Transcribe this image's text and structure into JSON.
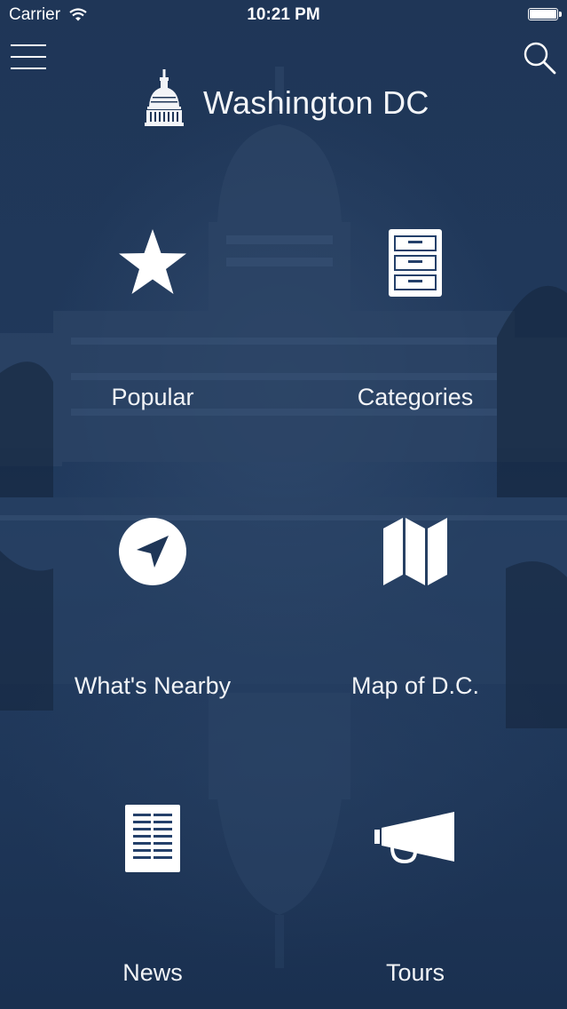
{
  "status_bar": {
    "carrier": "Carrier",
    "time": "10:21 PM"
  },
  "header": {
    "title": "Washington DC"
  },
  "tiles": [
    {
      "label": "Popular",
      "icon": "star-icon"
    },
    {
      "label": "Categories",
      "icon": "file-cabinet-icon"
    },
    {
      "label": "What's Nearby",
      "icon": "location-arrow-icon"
    },
    {
      "label": "Map of D.C.",
      "icon": "folded-map-icon"
    },
    {
      "label": "News",
      "icon": "newspaper-icon"
    },
    {
      "label": "Tours",
      "icon": "megaphone-icon"
    }
  ],
  "colors": {
    "background": "#1f3657",
    "foreground": "#ffffff"
  }
}
